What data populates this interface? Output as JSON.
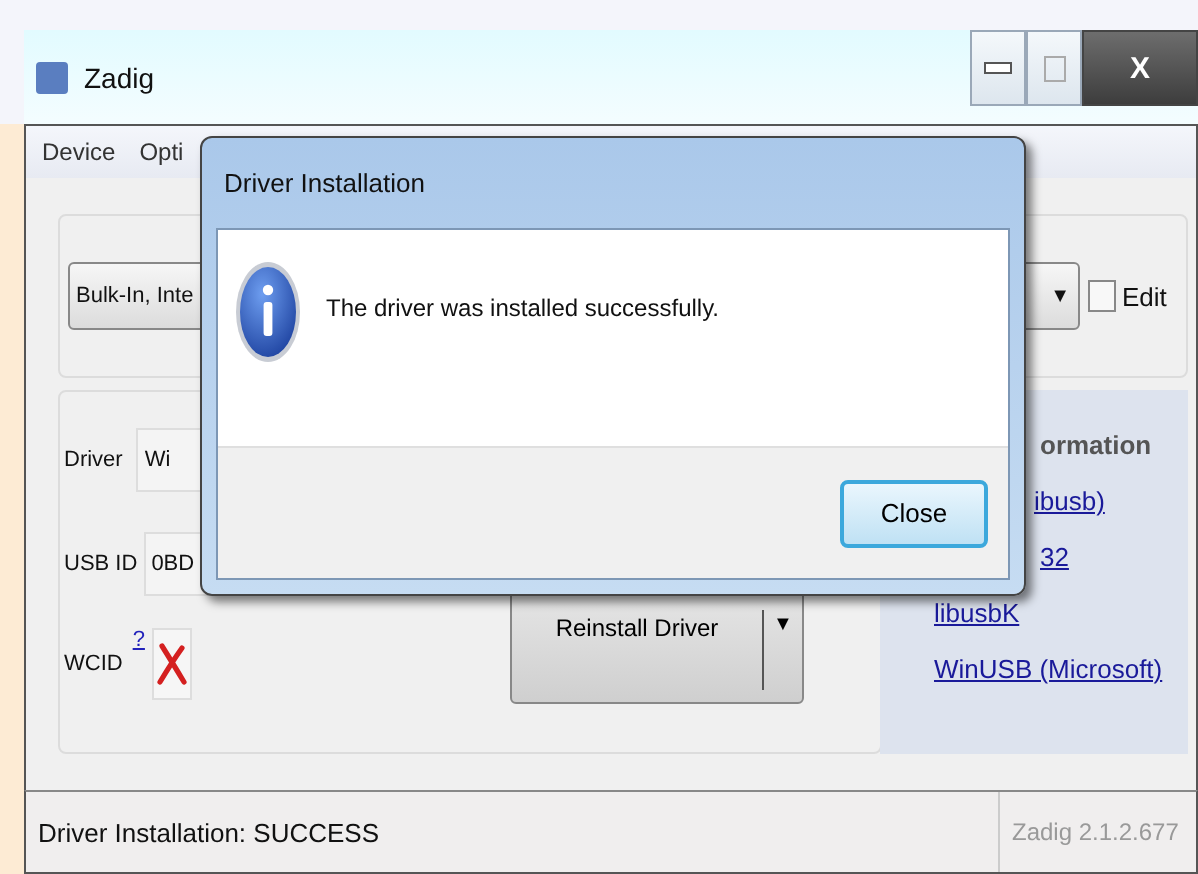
{
  "window": {
    "title": "Zadig",
    "close": "X"
  },
  "menu": [
    {
      "label": "Device"
    },
    {
      "label": "Opti"
    }
  ],
  "device_combo": {
    "value": "Bulk-In, Inte",
    "caret": "▼"
  },
  "edit_checkbox": {
    "label": "Edit",
    "checked": false
  },
  "driver_row": {
    "label": "Driver",
    "value": "Wi"
  },
  "usb_id_row": {
    "label": "USB ID",
    "value": "0BD"
  },
  "wcid": {
    "label": "WCID",
    "help": "?",
    "supported": false
  },
  "reinstall": {
    "label": "Reinstall Driver",
    "caret": "▼"
  },
  "info_panel": {
    "heading": "ormation",
    "links": [
      "ibusb)",
      "32",
      "libusbK",
      "WinUSB (Microsoft)"
    ]
  },
  "status_bar": {
    "message": "Driver Installation: SUCCESS",
    "version": "Zadig 2.1.2.677"
  },
  "dialog": {
    "title": "Driver Installation",
    "message": "The driver was installed successfully.",
    "button": "Close"
  }
}
